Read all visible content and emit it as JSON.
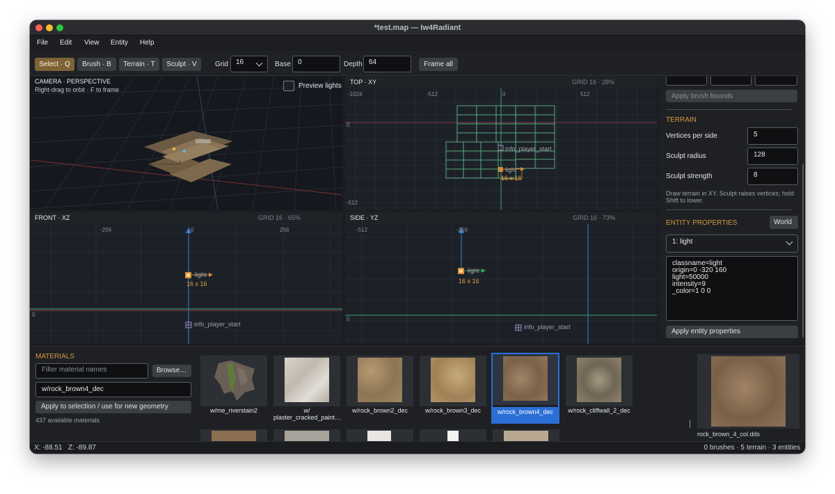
{
  "window": {
    "title": "*test.map — Iw4Radiant"
  },
  "menu": [
    "File",
    "Edit",
    "View",
    "Entity",
    "Help"
  ],
  "toolbar": {
    "tools": [
      "Select · Q",
      "Brush · B",
      "Terrain · T",
      "Sculpt · V"
    ],
    "grid_label": "Grid",
    "grid_value": "16",
    "base_label": "Base",
    "base_value": "0",
    "depth_label": "Depth",
    "depth_value": "64",
    "frame_all": "Frame all"
  },
  "camera": {
    "title": "CAMERA · PERSPECTIVE",
    "hint": "Right-drag to orbit · F to frame",
    "preview_lights": "Preview lights"
  },
  "views": {
    "top": {
      "title": "TOP · XY",
      "grid": "GRID 16 · 28%",
      "ticks_h": [
        "-1024",
        "-512",
        "0",
        "512"
      ],
      "ticks_v": [
        "0",
        "-512"
      ],
      "player": "info_player_start",
      "light": "light",
      "light_size": "16 x 16"
    },
    "front": {
      "title": "FRONT · XZ",
      "grid": "GRID 16 · 65%",
      "ticks_h": [
        "-256",
        "0",
        "256"
      ],
      "ticks_v": [
        "0"
      ],
      "player": "info_player_start",
      "light": "light",
      "light_size": "16 x 16"
    },
    "side": {
      "title": "SIDE · YZ",
      "grid": "GRID 16 · 73%",
      "ticks_h": [
        "-512",
        "-256"
      ],
      "ticks_v": [
        "0"
      ],
      "player": "info_player_start",
      "light": "light",
      "light_size": "16 x 16"
    }
  },
  "panel": {
    "apply_brush_bounds": "Apply brush bounds",
    "terrain_title": "TERRAIN",
    "vertices_label": "Vertices per side",
    "vertices_value": "5",
    "radius_label": "Sculpt radius",
    "radius_value": "128",
    "strength_label": "Sculpt strength",
    "strength_value": "8",
    "terrain_hint": "Draw terrain in XY. Sculpt raises vertices; hold Shift to lower.",
    "entity_title": "ENTITY PROPERTIES",
    "world_button": "World",
    "entity_select": "1: light",
    "entity_props": [
      "classname=light",
      "origin=0 -320 160",
      "light=50000",
      "intensity=9",
      "_color=1 0 0"
    ],
    "apply_entity": "Apply entity properties"
  },
  "materials": {
    "title": "MATERIALS",
    "filter_placeholder": "Filter material names",
    "browse": "Browse…",
    "current": "w/rock_brown4_dec",
    "apply": "Apply to selection / use for new geometry",
    "count": "437 available materials",
    "tiles": [
      "w/me_riverstain2",
      "w/\nplaster_cracked_paint…",
      "w/rock_brown2_dec",
      "w/rock_brown3_dec",
      "w/rock_brown4_dec",
      "w/rock_cliffwall_2_dec"
    ],
    "preview_name": "rock_brown_4_col.dds"
  },
  "status": {
    "coords": "X: -88.51   Z: -89.87",
    "summary": "0 brushes · 5 terrain · 3 entities"
  },
  "colors": {
    "accent": "#d49a3c",
    "selection": "#2b6fd6",
    "tool_active": "#7d6336"
  }
}
